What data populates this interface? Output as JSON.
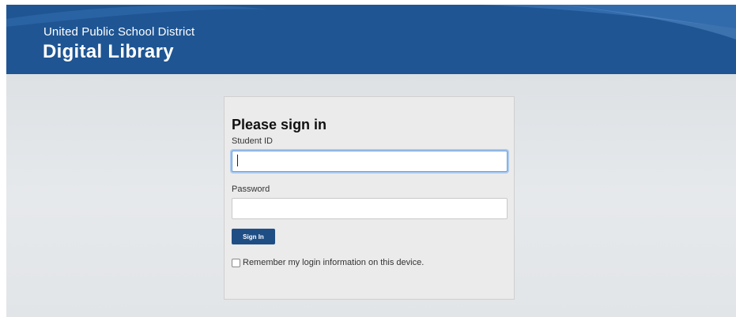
{
  "header": {
    "district": "United Public School District",
    "library": "Digital Library"
  },
  "login": {
    "title": "Please sign in",
    "student_id_label": "Student ID",
    "student_id_value": "",
    "password_label": "Password",
    "password_value": "",
    "sign_in_label": "Sign In",
    "remember_label": "Remember my login information on this device.",
    "remember_checked": false
  },
  "colors": {
    "header_bg": "#1f5593",
    "button_bg": "#1f4e85",
    "focus_ring": "#a9c8ee"
  }
}
